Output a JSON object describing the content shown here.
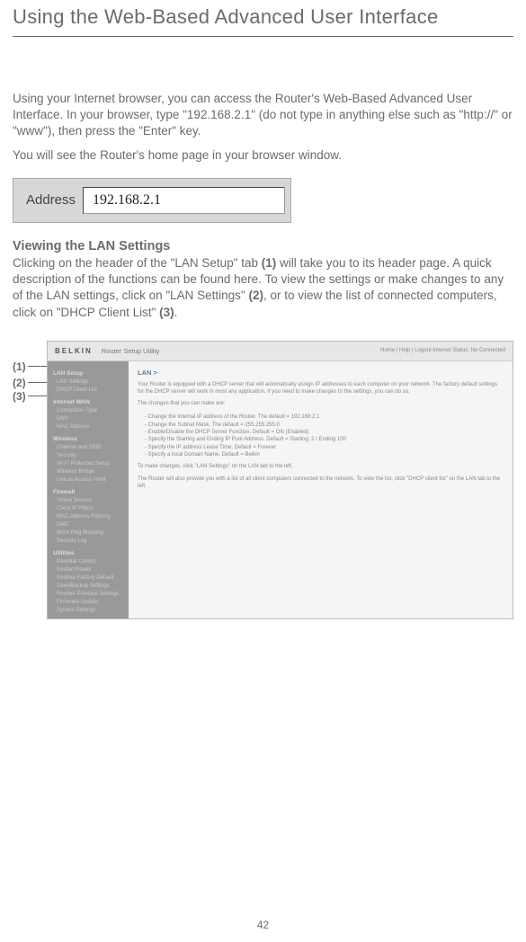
{
  "page": {
    "title": "Using the Web-Based Advanced User Interface",
    "number": "42"
  },
  "intro": {
    "p1": "Using your Internet browser, you can access the Router's Web-Based Advanced User Interface. In your browser, type \"192.168.2.1\" (do not type in anything else such as \"http://\" or \"www\"), then press the \"Enter\" key.",
    "p2": "You will see the Router's home page in your browser window."
  },
  "addressbar": {
    "label": "Address",
    "value": "192.168.2.1"
  },
  "section": {
    "heading": "Viewing the LAN Settings",
    "body_pre": "Clicking on the header of the \"LAN Setup\" tab ",
    "ref1": "(1)",
    "body_mid1": " will take you to its header page. A quick description of the functions can be found here. To view the settings or make changes to any of the LAN settings, click on \"LAN Settings\" ",
    "ref2": "(2)",
    "body_mid2": ", or to view the list of connected computers, click on \"DHCP Client List\" ",
    "ref3": "(3)",
    "body_end": "."
  },
  "callouts": {
    "c1": "(1)",
    "c2": "(2)",
    "c3": "(3)"
  },
  "screenshot": {
    "logo": "BELKIN",
    "utility": "Router Setup Utility",
    "status": "Home | Help | Logout   Internet Status: No Connected",
    "sidebar": {
      "g1": "LAN Setup",
      "g1i1": "LAN Settings",
      "g1i2": "DHCP Client List",
      "g2": "Internet WAN",
      "g2i1": "Connection Type",
      "g2i2": "DNS",
      "g2i3": "MAC Address",
      "g3": "Wireless",
      "g3i1": "Channel and SSID",
      "g3i2": "Security",
      "g3i3": "Wi-Fi Protected Setup",
      "g3i4": "Wireless Bridge",
      "g3i5": "Use as Access Point",
      "g4": "Firewall",
      "g4i1": "Virtual Servers",
      "g4i2": "Client IP Filters",
      "g4i3": "MAC Address Filtering",
      "g4i4": "DMZ",
      "g4i5": "WAN Ping Blocking",
      "g4i6": "Security Log",
      "g5": "Utilities",
      "g5i1": "Parental Control",
      "g5i2": "Restart Router",
      "g5i3": "Restore Factory Default",
      "g5i4": "Save/Backup Settings",
      "g5i5": "Restore Previous Settings",
      "g5i6": "Firmware Update",
      "g5i7": "System Settings"
    },
    "main": {
      "crumb": "LAN >",
      "p1": "Your Router is equipped with a DHCP server that will automatically assign IP addresses to each computer on your network. The factory default settings for the DHCP server will work in most any application. If you need to make changes to the settings, you can do so.",
      "p2": "The changes that you can make are:",
      "l1": "Change the Internal IP address of the Router. The default = 192.168.2.1",
      "l2": "Change the Subnet Mask. The default = 255.255.255.0",
      "l3": "Enable/Disable the DHCP Server Function. Default = ON (Enabled)",
      "l4": "Specify the Starting and Ending IP Pool Address. Default = Starting: 2 / Ending 100",
      "l5": "Specify the IP address Lease Time. Default = Forever",
      "l6": "Specify a local Domain Name. Default = Belkin",
      "p3": "To make changes, click \"LAN Settings\" on the LAN tab to the left.",
      "p4": "The Router will also provide you with a list of all client computers connected to the network. To view the list, click \"DHCP client list\" on the LAN tab to the left."
    }
  }
}
